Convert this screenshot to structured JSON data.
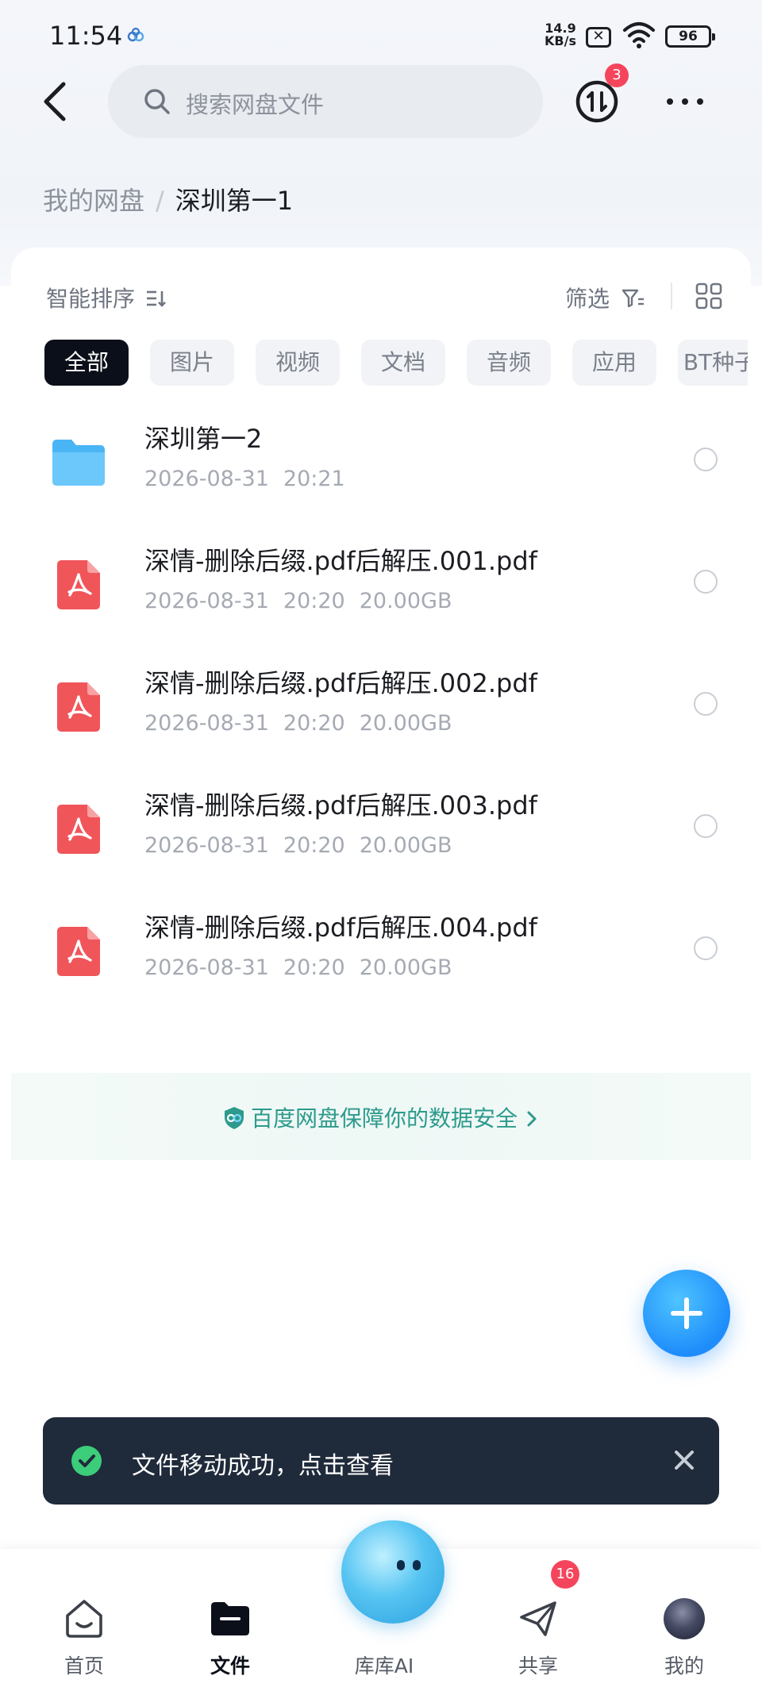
{
  "status_bar": {
    "time": "11:54",
    "net_speed_value": "14.9",
    "net_speed_unit": "KB/s",
    "sim_glyph": "✕",
    "battery": "96"
  },
  "header": {
    "search_placeholder": "搜索网盘文件",
    "transfer_badge": "3"
  },
  "breadcrumb": {
    "root": "我的网盘",
    "separator": "/",
    "current": "深圳第一1"
  },
  "toolbar": {
    "sort_label": "智能排序",
    "filter_label": "筛选"
  },
  "filter_chips": [
    {
      "label": "全部",
      "active": true
    },
    {
      "label": "图片"
    },
    {
      "label": "视频"
    },
    {
      "label": "文档"
    },
    {
      "label": "音频"
    },
    {
      "label": "应用"
    },
    {
      "label": "BT种子"
    }
  ],
  "files": [
    {
      "type": "folder",
      "icon": "folder-icon",
      "name": "深圳第一2",
      "date": "2026-08-31",
      "time": "20:21",
      "size": ""
    },
    {
      "type": "pdf",
      "icon": "pdf-icon",
      "name": "深情-删除后缀.pdf后解压.001.pdf",
      "date": "2026-08-31",
      "time": "20:20",
      "size": "20.00GB"
    },
    {
      "type": "pdf",
      "icon": "pdf-icon",
      "name": "深情-删除后缀.pdf后解压.002.pdf",
      "date": "2026-08-31",
      "time": "20:20",
      "size": "20.00GB"
    },
    {
      "type": "pdf",
      "icon": "pdf-icon",
      "name": "深情-删除后缀.pdf后解压.003.pdf",
      "date": "2026-08-31",
      "time": "20:20",
      "size": "20.00GB"
    },
    {
      "type": "pdf",
      "icon": "pdf-icon",
      "name": "深情-删除后缀.pdf后解压.004.pdf",
      "date": "2026-08-31",
      "time": "20:20",
      "size": "20.00GB"
    }
  ],
  "safety_banner": {
    "text": "百度网盘保障你的数据安全"
  },
  "toast": {
    "text": "文件移动成功，点击查看"
  },
  "tabbar": {
    "home": "首页",
    "files": "文件",
    "ai": "库库AI",
    "share": "共享",
    "share_badge": "16",
    "mine": "我的"
  },
  "colors": {
    "accent": "#1e8dfb",
    "pdf_red": "#f0555a",
    "folder_blue": "#49b5f5",
    "toast_bg": "#1f2a3a",
    "badge_red": "#f5455c",
    "safe_green": "#2d9a8c"
  }
}
